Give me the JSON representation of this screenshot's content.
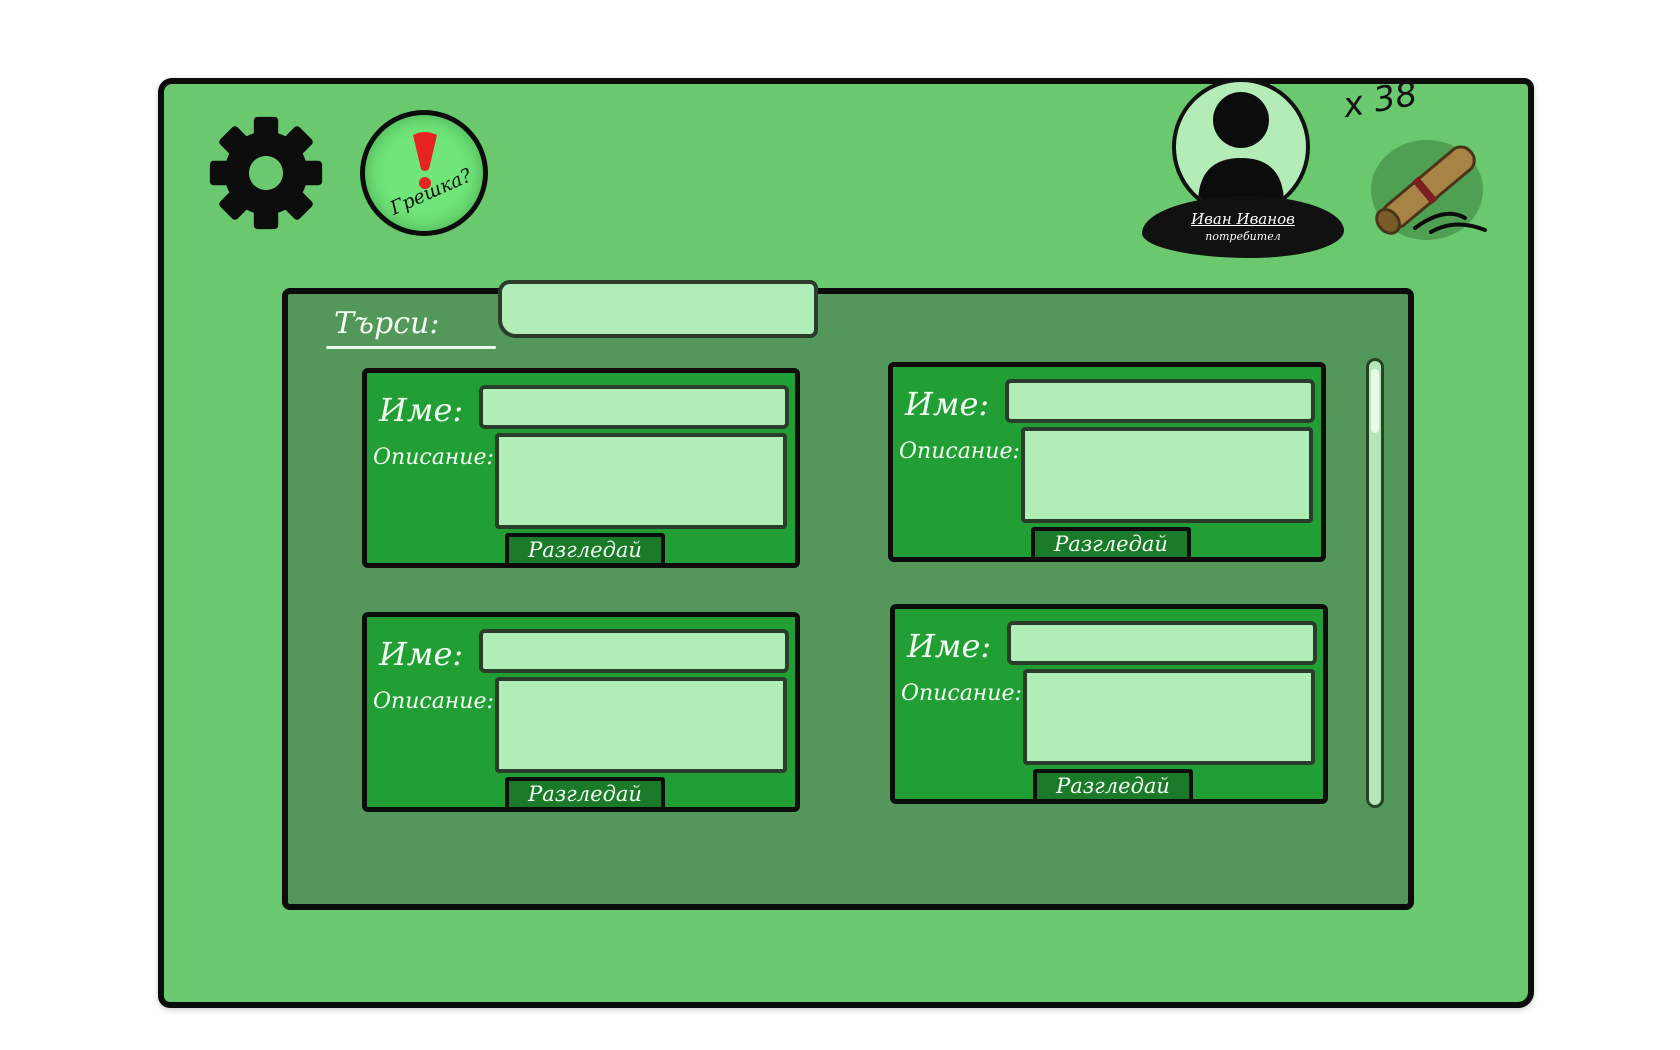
{
  "header": {
    "settings_icon": "gear-icon",
    "report_bug": {
      "icon": "exclamation-icon",
      "label": "Грешка?"
    },
    "user": {
      "name": "Иван Иванов",
      "role": "потребител",
      "avatar_icon": "person-icon"
    },
    "rewards": {
      "count": "x 38",
      "icon": "scroll-icon"
    }
  },
  "search": {
    "label": "Търси:",
    "value": ""
  },
  "cards": [
    {
      "name_label": "Име:",
      "desc_label": "Описание:",
      "name_value": "",
      "desc_value": "",
      "button_label": "Разгледай"
    },
    {
      "name_label": "Име:",
      "desc_label": "Описание:",
      "name_value": "",
      "desc_value": "",
      "button_label": "Разгледай"
    },
    {
      "name_label": "Име:",
      "desc_label": "Описание:",
      "name_value": "",
      "desc_value": "",
      "button_label": "Разгледай"
    },
    {
      "name_label": "Име:",
      "desc_label": "Описание:",
      "name_value": "",
      "desc_value": "",
      "button_label": "Разгледай"
    }
  ],
  "colors": {
    "frame": "#6ac86f",
    "content": "#53975a",
    "card": "#229f34",
    "input": "#b1edb6",
    "button": "#1b7a2a",
    "bug_button": "#6fe57a",
    "alert_red": "#e62222",
    "outline": "#0c0c0c"
  }
}
